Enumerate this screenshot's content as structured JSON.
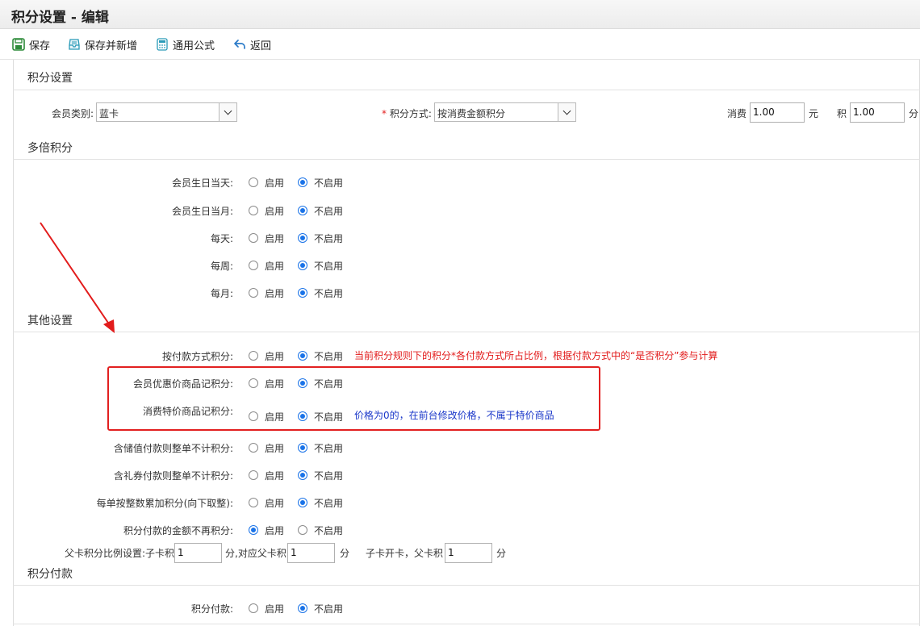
{
  "window": {
    "title": "积分设置 - 编辑"
  },
  "toolbar": {
    "save": "保存",
    "save_new": "保存并新增",
    "formula": "通用公式",
    "back": "返回"
  },
  "sections": {
    "points_settings": "积分设置",
    "multiple": "多倍积分",
    "other": "其他设置",
    "payment": "积分付款"
  },
  "settings": {
    "member_type_label": "会员类别:",
    "member_type_value": "蓝卡",
    "required_mark": "*",
    "method_label": "积分方式:",
    "method_value": "按消费金额积分",
    "consume_label": "消费",
    "consume_value": "1.00",
    "yuan": "元",
    "points_label": "积",
    "points_value": "1.00",
    "fen": "分"
  },
  "radio_labels": {
    "on": "启用",
    "off": "不启用"
  },
  "multiple_rows": [
    {
      "label": "会员生日当天:",
      "selected": "off"
    },
    {
      "label": "会员生日当月:",
      "selected": "off"
    },
    {
      "label": "每天:",
      "selected": "off"
    },
    {
      "label": "每周:",
      "selected": "off"
    },
    {
      "label": "每月:",
      "selected": "off"
    }
  ],
  "other_rows": [
    {
      "label": "按付款方式积分:",
      "selected": "off"
    },
    {
      "label": "会员优惠价商品记积分:",
      "selected": "off"
    },
    {
      "label": "消费特价商品记积分:",
      "selected": "off"
    },
    {
      "label": "含储值付款则整单不计积分:",
      "selected": "off"
    },
    {
      "label": "含礼券付款则整单不计积分:",
      "selected": "off"
    },
    {
      "label": "每单按整数累加积分(向下取整):",
      "selected": "off"
    },
    {
      "label": "积分付款的金额不再积分:",
      "selected": "on"
    }
  ],
  "notes": {
    "payment_method": "当前积分规则下的积分*各付款方式所占比例，根据付款方式中的“是否积分”参与计算",
    "special_price": "价格为0的，在前台修改价格，不属于特价商品"
  },
  "ratio": {
    "label": "父卡积分比例设置:子卡积",
    "child_value": "1",
    "mid": "分,对应父卡积",
    "parent_value": "1",
    "fen": "分",
    "open_label": "子卡开卡，父卡积",
    "open_value": "1",
    "fen2": "分"
  },
  "payment_rows": [
    {
      "label": "积分付款:",
      "selected": "off"
    }
  ],
  "colors": {
    "accent": "#1a73e8",
    "annotation": "#e21b1b",
    "note_blue": "#1a37c9"
  }
}
